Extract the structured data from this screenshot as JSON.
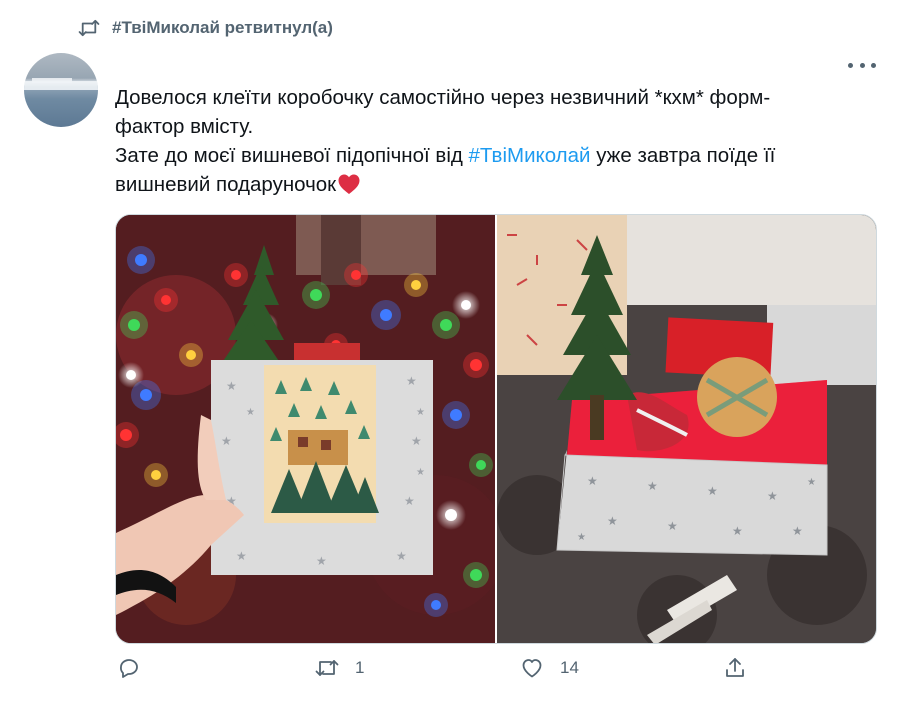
{
  "retweet": {
    "text": "#ТвіМиколай ретвитнул(а)"
  },
  "tweet": {
    "lines": [
      "Довелося клеїти коробочку самостійно через незвичний *кхм* форм-",
      "фактор вмісту."
    ],
    "line3_before": "Зате до моєї вишневої підопічної від ",
    "line3_hashtag": "#ТвіМиколай",
    "line3_after": " уже завтра поїде її",
    "line4": "вишневий подаруночок",
    "emoji": "red-heart-emoji"
  },
  "media": {
    "photos": [
      {
        "name": "gift-card-with-fir-photo"
      },
      {
        "name": "gift-box-with-fir-photo"
      }
    ]
  },
  "actions": {
    "reply_count": "",
    "retweet_count": "1",
    "like_count": "14",
    "share_count": ""
  },
  "icons": {
    "retweet_header": "retweet-icon",
    "more": "more-dots-icon",
    "reply": "reply-icon",
    "retweet": "retweet-icon",
    "like": "heart-outline-icon",
    "share": "share-icon"
  },
  "colors": {
    "hashtag": "#1d9bf0",
    "secondary_text": "#536471",
    "heart": "#e0245e"
  }
}
